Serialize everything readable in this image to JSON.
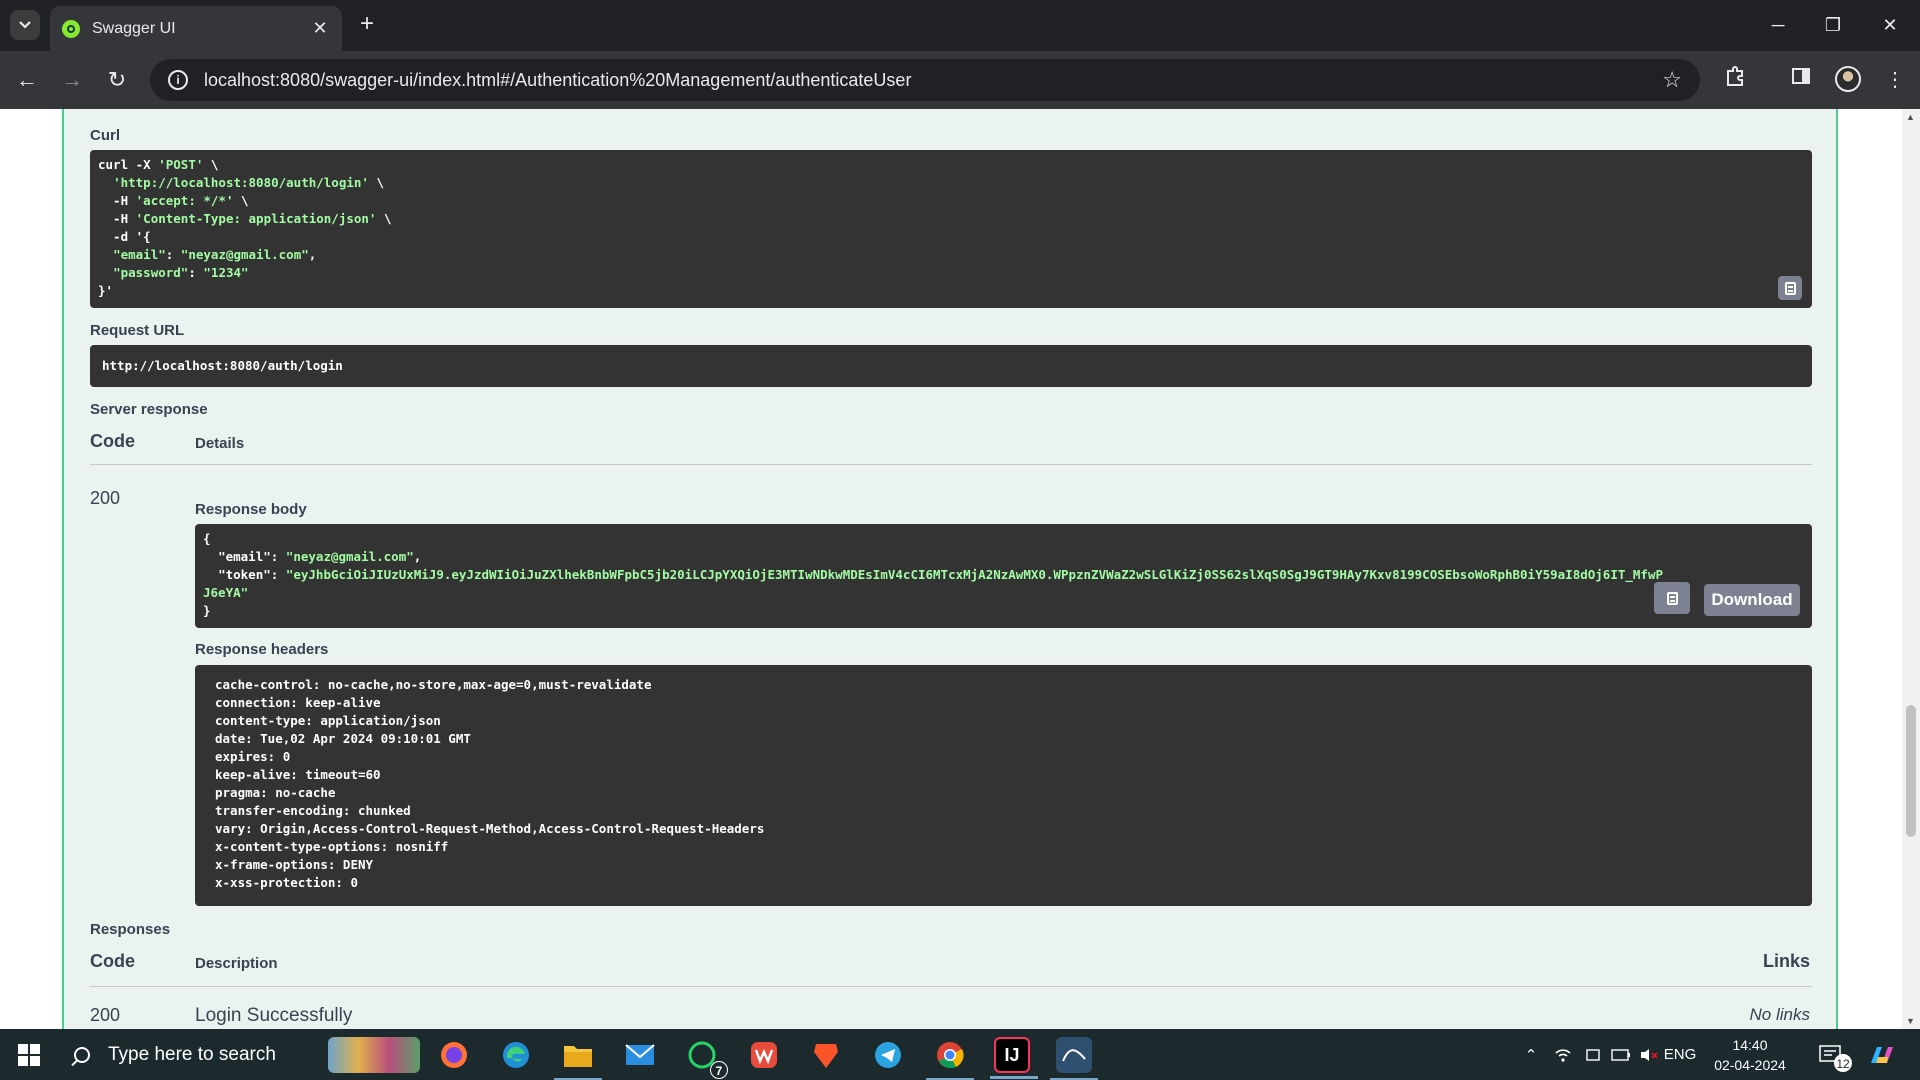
{
  "browser": {
    "tab_title": "Swagger UI",
    "tab_close": "✕",
    "new_tab": "+",
    "url": "localhost:8080/swagger-ui/index.html#/Authentication%20Management/authenticateUser",
    "info_glyph": "i",
    "controls": {
      "minimize": "─",
      "restore": "❐",
      "close": "✕"
    },
    "nav": {
      "back": "←",
      "forward": "→",
      "reload": "↻"
    }
  },
  "swagger": {
    "curl_label": "Curl",
    "curl_lines": [
      "curl -X 'POST' \\",
      "  'http://localhost:8080/auth/login' \\",
      "  -H 'accept: */*' \\",
      "  -H 'Content-Type: application/json' \\",
      "  -d '{",
      "  \"email\": \"neyaz@gmail.com\",",
      "  \"password\": \"1234\"",
      "}'"
    ],
    "request_url_label": "Request URL",
    "request_url": "http://localhost:8080/auth/login",
    "server_response_label": "Server response",
    "code_header": "Code",
    "details_header": "Details",
    "status_code": "200",
    "response_body_label": "Response body",
    "response_body": {
      "open": "{",
      "email_key": "\"email\"",
      "email_value": "\"neyaz@gmail.com\"",
      "token_key": "\"token\"",
      "token_value_line1": "\"eyJhbGciOiJIUzUxMiJ9.eyJzdWIiOiJuZXlhekBnbWFpbC5jb20iLCJpYXQiOjE3MTIwNDkwMDEsImV4cCI6MTcxMjA2NzAwMX0.WPpznZVWaZ2wSLGlKiZj0SS62slXqS0SgJ9GT9HAy7Kxv8199COSEbsoWoRphB0iY59aI8dOj6IT_MfwP",
      "token_value_line2": "J6eYA\"",
      "close": "}"
    },
    "download_label": "Download",
    "response_headers_label": "Response headers",
    "response_headers": [
      "cache-control: no-cache,no-store,max-age=0,must-revalidate",
      "connection: keep-alive",
      "content-type: application/json",
      "date: Tue,02 Apr 2024 09:10:01 GMT",
      "expires: 0",
      "keep-alive: timeout=60",
      "pragma: no-cache",
      "transfer-encoding: chunked",
      "vary: Origin,Access-Control-Request-Method,Access-Control-Request-Headers",
      "x-content-type-options: nosniff",
      "x-frame-options: DENY",
      "x-xss-protection: 0"
    ],
    "responses_label": "Responses",
    "responses_code_header": "Code",
    "responses_description_header": "Description",
    "responses_links_header": "Links",
    "responses_row_code": "200",
    "responses_row_description": "Login Successfully",
    "responses_row_links": "No links"
  },
  "taskbar": {
    "search_placeholder": "Type here to search",
    "whatsapp_badge": "7",
    "intellij_label": "IJ",
    "language": "ENG",
    "time": "14:40",
    "date": "02-04-2024",
    "notification_count": "12"
  },
  "colors": {
    "swagger_green": "#49cc90",
    "opblock_bg": "#ebf3f0",
    "code_bg": "#333333",
    "string_green": "#a2fca2",
    "chrome_dark": "#202124",
    "taskbar_bg": "#1c2a2e"
  }
}
